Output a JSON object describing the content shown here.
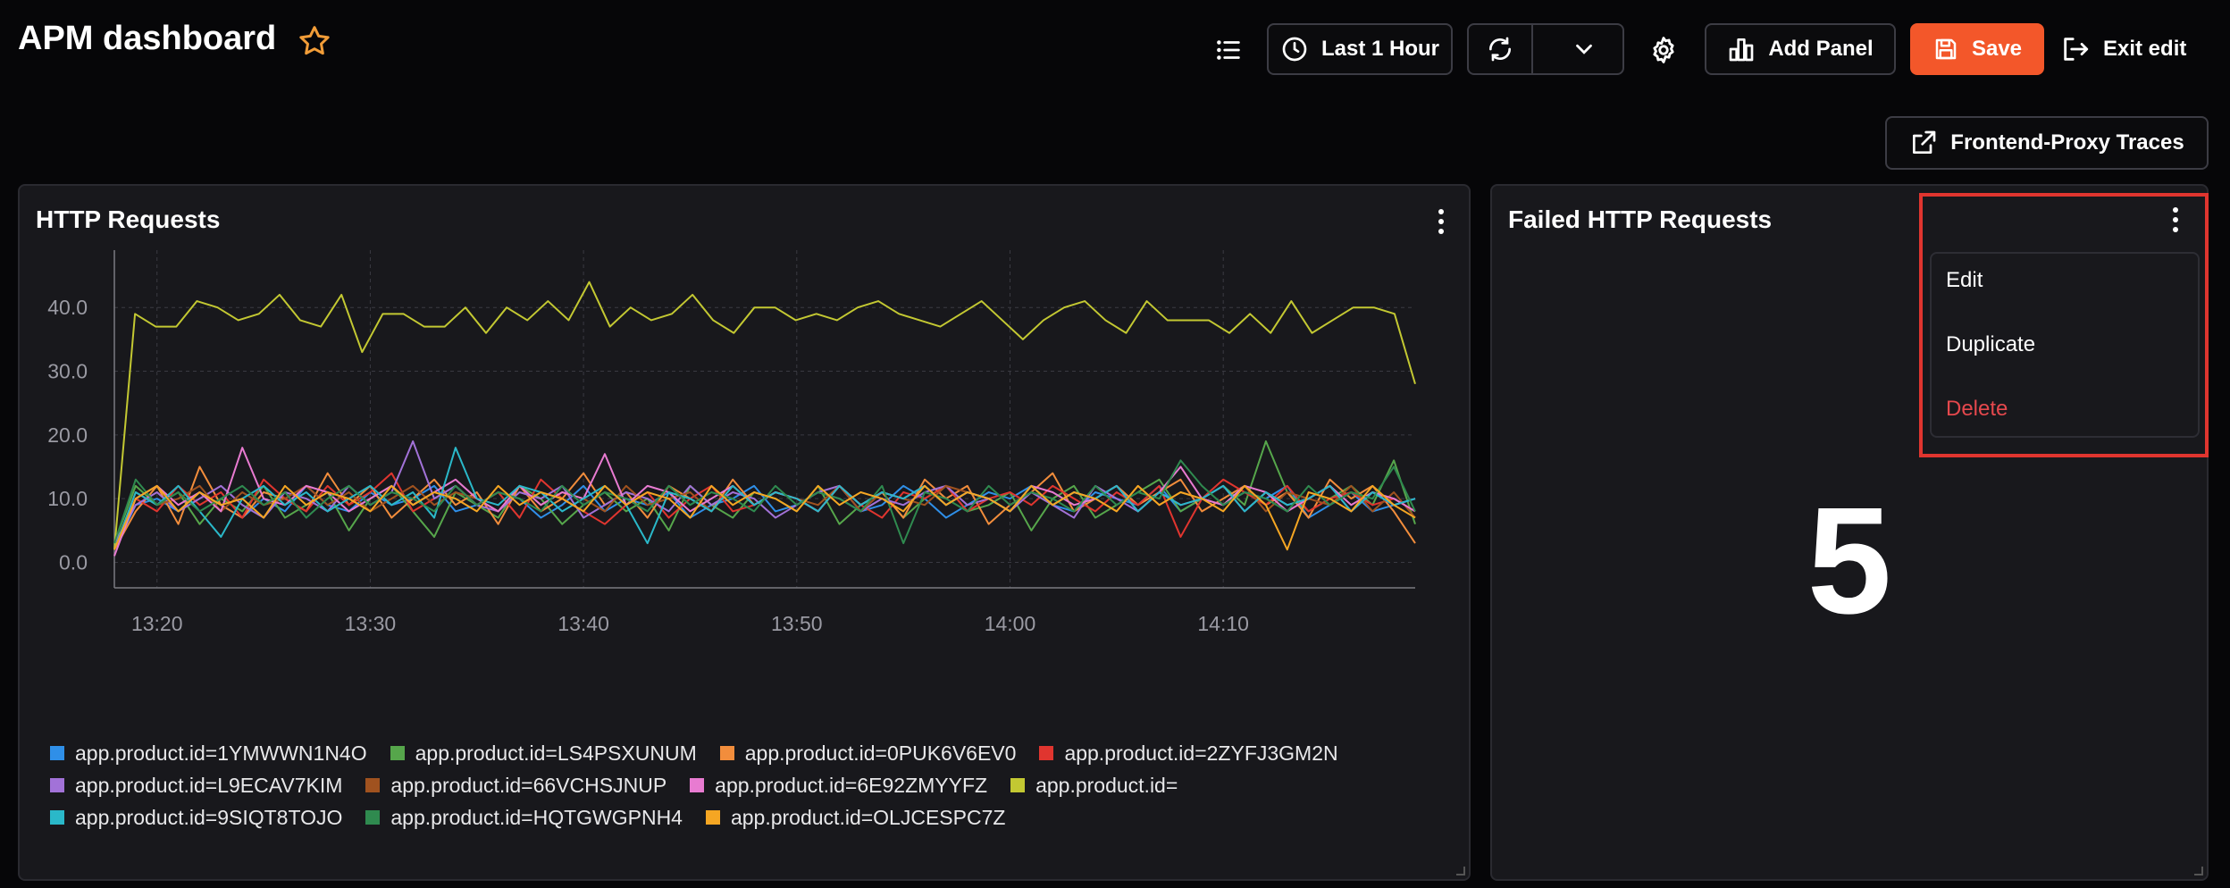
{
  "header": {
    "title": "APM dashboard",
    "time_range_label": "Last 1 Hour",
    "add_panel_label": "Add Panel",
    "save_label": "Save",
    "exit_label": "Exit edit",
    "traces_link_label": "Frontend-Proxy Traces"
  },
  "colors": {
    "accent": "#f3572a",
    "danger": "#e5484d",
    "highlight": "#e0352f",
    "background": "#060608",
    "panel": "#18181c"
  },
  "icons": [
    "star-icon",
    "list-icon",
    "clock-icon",
    "refresh-icon",
    "chevron-down-icon",
    "gear-icon",
    "bar-chart-icon",
    "save-icon",
    "exit-icon",
    "external-link-icon",
    "kebab-icon"
  ],
  "panels": {
    "http_requests": {
      "title": "HTTP Requests"
    },
    "failed_http_requests": {
      "title": "Failed HTTP Requests",
      "value": "5",
      "menu": {
        "edit_label": "Edit",
        "duplicate_label": "Duplicate",
        "delete_label": "Delete"
      }
    }
  },
  "chart_data": {
    "type": "line",
    "title": "HTTP Requests",
    "xlabel": "",
    "ylabel": "",
    "ylim": [
      -4,
      49
    ],
    "y_ticks": [
      "0.0",
      "10.0",
      "20.0",
      "30.0",
      "40.0"
    ],
    "x_ticks": [
      "13:20",
      "13:30",
      "13:40",
      "13:50",
      "14:00",
      "14:10"
    ],
    "x_tick_minutes": [
      1,
      11,
      21,
      31,
      41,
      51
    ],
    "x_range_minutes": [
      -1,
      60
    ],
    "grid": true,
    "legend_position": "bottom",
    "x_minutes": [
      -1,
      0,
      1,
      2,
      3,
      4,
      5,
      6,
      7,
      8,
      9,
      10,
      11,
      12,
      13,
      14,
      15,
      16,
      17,
      18,
      19,
      20,
      21,
      22,
      23,
      24,
      25,
      26,
      27,
      28,
      29,
      30,
      31,
      32,
      33,
      34,
      35,
      36,
      37,
      38,
      39,
      40,
      41,
      42,
      43,
      44,
      45,
      46,
      47,
      48,
      49,
      50,
      51,
      52,
      53,
      54,
      55,
      56,
      57,
      58,
      59,
      60
    ],
    "series": [
      {
        "name": "app.product.id=1YMWWN1N4O",
        "color": "#2f8fe8",
        "values": [
          2,
          9,
          10,
          8,
          11,
          9,
          7,
          10,
          8,
          12,
          9,
          8,
          11,
          9,
          10,
          12,
          8,
          9,
          11,
          10,
          7,
          9,
          12,
          8,
          10,
          9,
          11,
          7,
          9,
          10,
          12,
          8,
          9,
          11,
          10,
          8,
          9,
          12,
          10,
          7,
          9,
          11,
          10,
          12,
          9,
          8,
          11,
          10,
          9,
          12,
          8,
          10,
          9,
          11,
          10,
          12,
          7,
          9,
          11,
          8,
          9,
          10
        ]
      },
      {
        "name": "app.product.id=LS4PSXUNUM",
        "color": "#56a64b",
        "values": [
          3,
          12,
          9,
          11,
          6,
          10,
          8,
          12,
          7,
          9,
          11,
          5,
          10,
          12,
          8,
          4,
          11,
          9,
          7,
          12,
          10,
          6,
          9,
          11,
          8,
          10,
          5,
          12,
          9,
          7,
          11,
          10,
          8,
          12,
          6,
          9,
          11,
          7,
          10,
          12,
          8,
          9,
          11,
          5,
          10,
          12,
          7,
          9,
          11,
          13,
          8,
          10,
          12,
          9,
          19,
          11,
          8,
          10,
          12,
          9,
          16,
          6
        ]
      },
      {
        "name": "app.product.id=0PUK6V6EV0",
        "color": "#f28d3c",
        "values": [
          2,
          8,
          12,
          6,
          15,
          9,
          7,
          11,
          10,
          8,
          14,
          9,
          12,
          7,
          10,
          13,
          9,
          11,
          6,
          12,
          8,
          10,
          14,
          9,
          11,
          7,
          12,
          10,
          8,
          13,
          9,
          11,
          10,
          8,
          12,
          9,
          11,
          7,
          13,
          10,
          12,
          6,
          9,
          11,
          14,
          8,
          10,
          12,
          9,
          11,
          13,
          8,
          10,
          12,
          9,
          11,
          7,
          13,
          10,
          12,
          8,
          3
        ]
      },
      {
        "name": "app.product.id=2ZYFJ3GM2N",
        "color": "#e0352f",
        "values": [
          2,
          10,
          8,
          12,
          9,
          11,
          7,
          13,
          10,
          8,
          12,
          9,
          11,
          14,
          8,
          10,
          12,
          9,
          11,
          7,
          13,
          10,
          8,
          6,
          9,
          11,
          7,
          10,
          12,
          8,
          9,
          11,
          10,
          8,
          12,
          9,
          7,
          11,
          10,
          12,
          8,
          10,
          11,
          9,
          12,
          10,
          8,
          11,
          9,
          12,
          4,
          10,
          13,
          11,
          9,
          12,
          8,
          10,
          11,
          9,
          10,
          8
        ]
      },
      {
        "name": "app.product.id=L9ECAV7KIM",
        "color": "#a272d8",
        "values": [
          3,
          9,
          11,
          8,
          10,
          12,
          9,
          7,
          11,
          10,
          8,
          12,
          9,
          11,
          19,
          10,
          12,
          9,
          8,
          11,
          10,
          12,
          7,
          9,
          11,
          10,
          8,
          12,
          9,
          11,
          10,
          7,
          9,
          11,
          12,
          8,
          10,
          9,
          11,
          12,
          9,
          10,
          8,
          11,
          9,
          7,
          12,
          10,
          8,
          11,
          9,
          10,
          12,
          8,
          11,
          9,
          10,
          12,
          8,
          11,
          9,
          10
        ]
      },
      {
        "name": "app.product.id=66VCHSJNUP",
        "color": "#a0521f",
        "values": [
          2,
          11,
          9,
          10,
          12,
          8,
          11,
          9,
          10,
          12,
          9,
          11,
          8,
          10,
          12,
          9,
          11,
          10,
          8,
          12,
          9,
          11,
          10,
          8,
          12,
          9,
          10,
          11,
          8,
          12,
          9,
          11,
          10,
          9,
          12,
          8,
          11,
          10,
          9,
          12,
          11,
          10,
          8,
          12,
          9,
          11,
          10,
          8,
          12,
          9,
          11,
          10,
          9,
          12,
          8,
          11,
          10,
          9,
          12,
          8,
          11,
          7
        ]
      },
      {
        "name": "app.product.id=6E92ZMYYFZ",
        "color": "#e87bd1",
        "values": [
          1,
          10,
          12,
          9,
          11,
          8,
          18,
          10,
          9,
          12,
          11,
          8,
          10,
          12,
          9,
          11,
          13,
          10,
          8,
          12,
          9,
          11,
          10,
          17,
          9,
          12,
          11,
          8,
          10,
          12,
          9,
          11,
          10,
          8,
          12,
          9,
          11,
          10,
          12,
          9,
          11,
          10,
          8,
          12,
          11,
          9,
          10,
          12,
          8,
          11,
          15,
          10,
          9,
          12,
          11,
          8,
          10,
          12,
          9,
          11,
          10,
          8
        ]
      },
      {
        "name": "app.product.id=",
        "color": "#c3c832",
        "values": [
          2,
          39,
          37,
          37,
          41,
          40,
          38,
          39,
          42,
          38,
          37,
          42,
          33,
          39,
          39,
          37,
          37,
          40,
          36,
          40,
          38,
          41,
          38,
          44,
          37,
          40,
          38,
          39,
          42,
          38,
          36,
          40,
          40,
          38,
          39,
          38,
          40,
          41,
          39,
          38,
          37,
          39,
          41,
          38,
          35,
          38,
          40,
          41,
          38,
          36,
          41,
          38,
          38,
          38,
          36,
          39,
          36,
          41,
          36,
          38,
          40,
          40,
          39,
          28
        ]
      },
      {
        "name": "app.product.id=9SIQT8TOJO",
        "color": "#2ab8c9",
        "values": [
          2,
          11,
          9,
          12,
          8,
          4,
          10,
          12,
          9,
          11,
          8,
          10,
          12,
          9,
          11,
          7,
          18,
          10,
          9,
          12,
          11,
          8,
          10,
          12,
          9,
          3,
          11,
          10,
          8,
          12,
          9,
          11,
          10,
          8,
          12,
          9,
          11,
          10,
          12,
          9,
          11,
          10,
          8,
          12,
          9,
          11,
          10,
          12,
          8,
          11,
          9,
          10,
          12,
          8,
          11,
          9,
          10,
          12,
          8,
          11,
          9,
          10
        ]
      },
      {
        "name": "app.product.id=HQTGWGPNH4",
        "color": "#2f8a4f",
        "values": [
          3,
          13,
          9,
          11,
          8,
          10,
          12,
          9,
          11,
          7,
          10,
          12,
          9,
          11,
          10,
          8,
          12,
          9,
          11,
          10,
          8,
          12,
          9,
          11,
          10,
          8,
          12,
          9,
          11,
          10,
          8,
          12,
          9,
          11,
          10,
          8,
          12,
          3,
          11,
          10,
          8,
          12,
          9,
          11,
          10,
          8,
          12,
          9,
          11,
          10,
          16,
          12,
          9,
          11,
          10,
          8,
          12,
          9,
          11,
          10,
          15,
          8
        ]
      },
      {
        "name": "app.product.id=OLJCESPC7Z",
        "color": "#f5a623",
        "values": [
          2,
          10,
          12,
          8,
          11,
          9,
          10,
          7,
          12,
          9,
          11,
          10,
          8,
          12,
          9,
          11,
          10,
          8,
          12,
          9,
          11,
          10,
          8,
          12,
          9,
          11,
          10,
          7,
          12,
          9,
          11,
          10,
          8,
          12,
          9,
          11,
          10,
          8,
          12,
          9,
          11,
          10,
          8,
          12,
          9,
          11,
          10,
          8,
          12,
          9,
          11,
          10,
          8,
          12,
          9,
          2,
          11,
          10,
          8,
          12,
          9,
          7
        ]
      }
    ]
  }
}
